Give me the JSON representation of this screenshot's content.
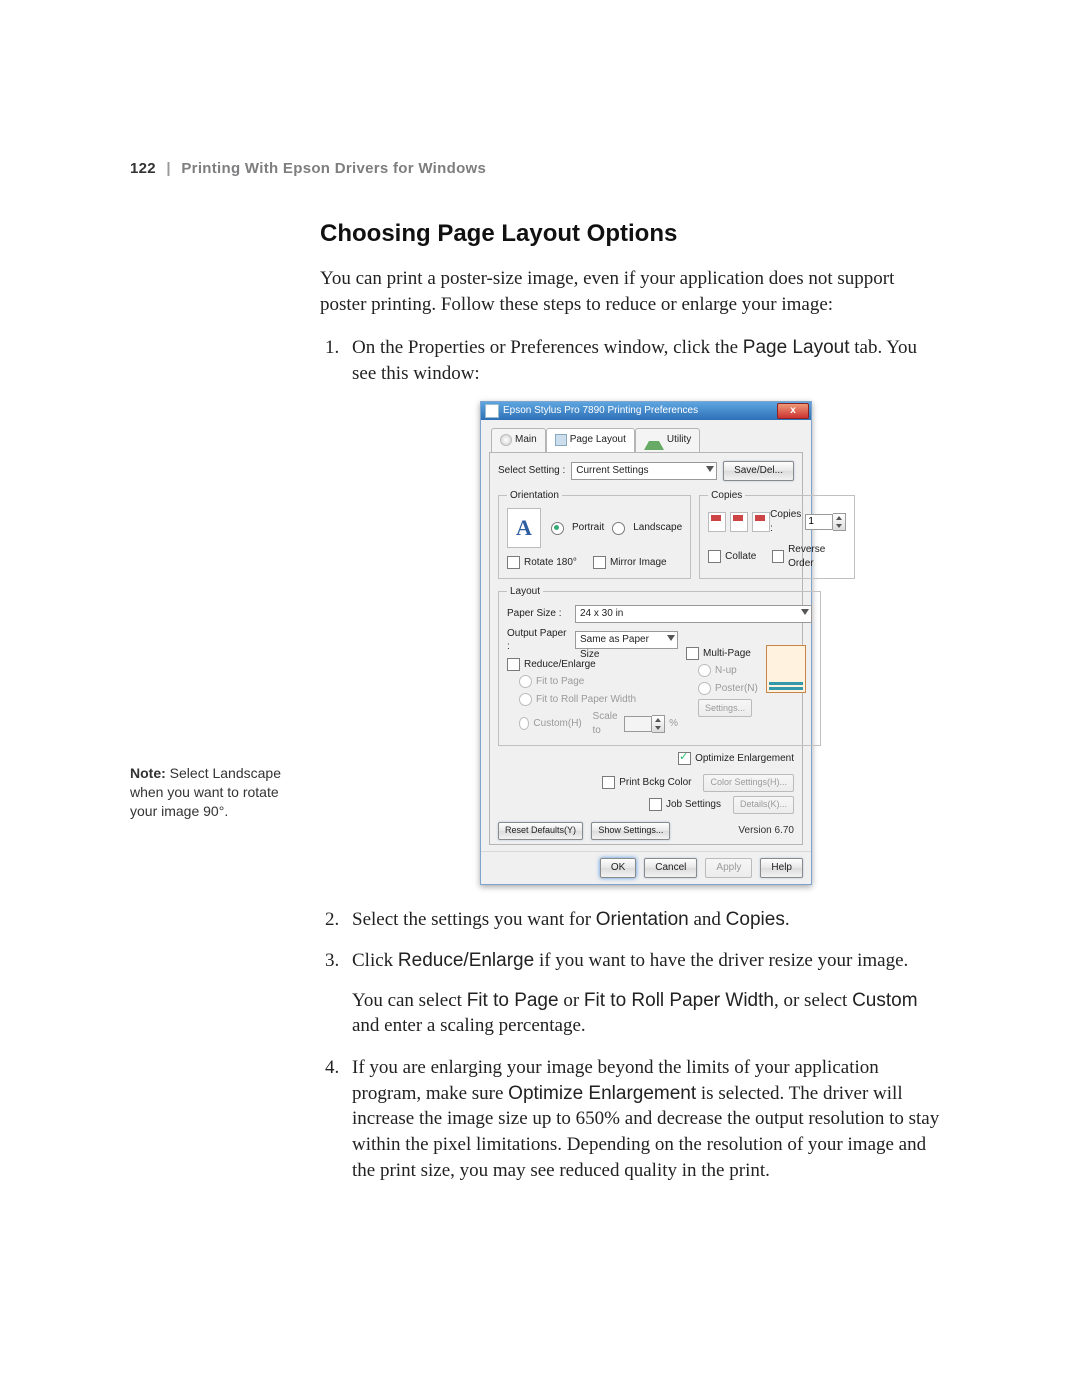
{
  "header": {
    "page_number": "122",
    "separator": "|",
    "title": "Printing With Epson Drivers for Windows"
  },
  "section": {
    "title": "Choosing Page Layout Options",
    "intro": "You can print a poster-size image, even if your application does not support poster printing. Follow these steps to reduce or enlarge your image:",
    "step1_a": "On the Properties or Preferences window, click the ",
    "step1_term": "Page Layout",
    "step1_b": " tab. You see this window:",
    "step2_a": "Select the settings you want for ",
    "step2_t1": "Orientation",
    "step2_mid": " and ",
    "step2_t2": "Copies",
    "step2_end": ".",
    "step3_a": "Click ",
    "step3_t1": "Reduce/Enlarge",
    "step3_b": " if you want to have the driver resize your image.",
    "step3_p2_a": "You can select ",
    "step3_p2_t1": "Fit to Page",
    "step3_p2_mid": " or ",
    "step3_p2_t2": "Fit to Roll Paper Width",
    "step3_p2_b": ", or select ",
    "step3_p2_t3": "Custom",
    "step3_p2_c": " and enter a scaling percentage.",
    "step4_a": "If you are enlarging your image beyond the limits of your application program, make sure ",
    "step4_t1": "Optimize Enlargement",
    "step4_b": " is selected. The driver will increase the image size up to 650% and decrease the output resolution to stay within the pixel limitations. Depending on the resolution of your image and the print size, you may see reduced quality in the print."
  },
  "margin_note": {
    "bold": "Note:",
    "t1": " Select ",
    "term": "Landscape",
    "t2": " when you want to rotate your image 90°."
  },
  "dialog": {
    "title": "Epson Stylus Pro 7890 Printing Preferences",
    "close": "x",
    "tabs": {
      "main": "Main",
      "layout": "Page Layout",
      "utility": "Utility"
    },
    "select_setting_label": "Select Setting :",
    "select_setting_value": "Current Settings",
    "save_del": "Save/Del...",
    "orientation": {
      "legend": "Orientation",
      "portrait": "Portrait",
      "landscape": "Landscape",
      "rotate": "Rotate 180°",
      "mirror": "Mirror Image"
    },
    "copies": {
      "legend": "Copies",
      "copies_label": "Copies :",
      "copies_value": "1",
      "collate": "Collate",
      "reverse": "Reverse Order"
    },
    "layout": {
      "legend": "Layout",
      "paper_size_label": "Paper Size :",
      "paper_size_value": "24 x 30 in",
      "output_paper_label": "Output Paper :",
      "output_paper_value": "Same as Paper Size",
      "reduce_enlarge": "Reduce/Enlarge",
      "fit_page": "Fit to Page",
      "fit_roll": "Fit to Roll Paper Width",
      "custom": "Custom(H)",
      "scale_to": "Scale to",
      "multipage": "Multi-Page",
      "nup": "N-up",
      "poster": "Poster(N)",
      "settings": "Settings...",
      "percent": "%"
    },
    "opt_enlargement": "Optimize Enlargement",
    "print_bckg": "Print Bckg Color",
    "color_settings": "Color Settings(H)...",
    "job_settings": "Job Settings",
    "details": "Details(K)...",
    "reset_defaults": "Reset Defaults(Y)",
    "show_settings": "Show Settings...",
    "version": "Version 6.70",
    "footer": {
      "ok": "OK",
      "cancel": "Cancel",
      "apply": "Apply",
      "help": "Help"
    }
  }
}
